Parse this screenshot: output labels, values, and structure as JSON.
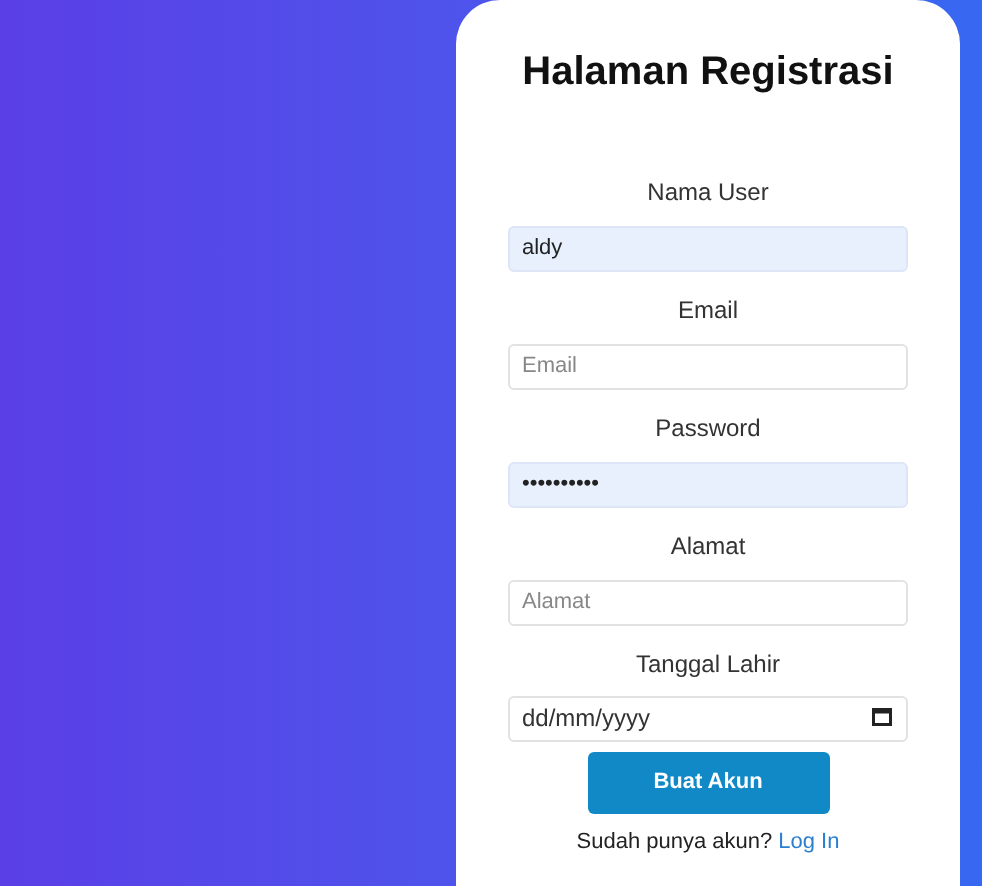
{
  "title": "Halaman Registrasi",
  "fields": [
    {
      "label": "Nama User",
      "kind": "text",
      "value": "aldy",
      "autofilled": true
    },
    {
      "label": "Email",
      "kind": "text",
      "placeholder": "Email",
      "autofilled": false
    },
    {
      "label": "Password",
      "kind": "text",
      "value": "••••••••••",
      "autofilled": true
    },
    {
      "label": "Alamat",
      "kind": "text",
      "placeholder": "Alamat",
      "autofilled": false
    },
    {
      "label": "Tanggal Lahir",
      "kind": "date",
      "placeholder": "dd/mm/yyyy",
      "autofilled": false
    }
  ],
  "submit": "Buat Akun",
  "footer": {
    "text": "Sudah punya akun?",
    "link": "Log In"
  }
}
